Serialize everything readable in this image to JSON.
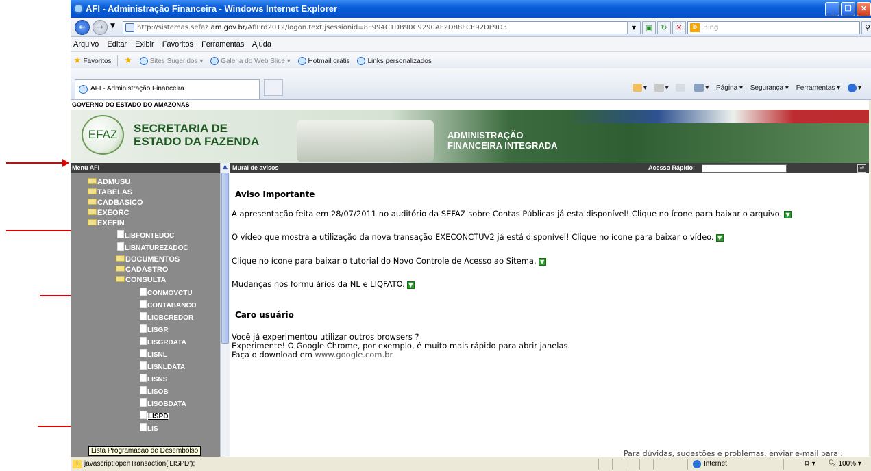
{
  "window": {
    "title": "AFI - Administração Financeira - Windows Internet Explorer",
    "url_prefix": "http://sistemas.sefaz.",
    "url_domain": "am.gov.br",
    "url_suffix": "/AfiPrd2012/logon.text;jsessionid=8F994C1DB90C9290AF2D88FCE92DF9D3",
    "search_placeholder": "Bing",
    "search_logo": "b"
  },
  "menubar": [
    "Arquivo",
    "Editar",
    "Exibir",
    "Favoritos",
    "Ferramentas",
    "Ajuda"
  ],
  "favorites": {
    "label": "Favoritos",
    "items": [
      "Sites Sugeridos ▾",
      "Galeria do Web Slice ▾",
      "Hotmail grátis",
      "Links personalizados"
    ]
  },
  "tab": {
    "title": "AFI - Administração Financeira"
  },
  "commands": {
    "page": "Página ▾",
    "security": "Segurança ▾",
    "tools": "Ferramentas ▾"
  },
  "page": {
    "gov_prefix": "GOVERNO DO ESTADO DO ",
    "gov_state": "AMAZONAS",
    "logo_text": "EFAZ",
    "sec_line1": "SECRETARIA DE",
    "sec_line2": "ESTADO DA FAZENDA",
    "afi_line1": "ADMINISTRAÇÃO",
    "afi_line2": "FINANCEIRA INTEGRADA"
  },
  "menu": {
    "header": "Menu AFI",
    "items": [
      {
        "label": "ADMUSU",
        "type": "folder"
      },
      {
        "label": "TABELAS",
        "type": "folder"
      },
      {
        "label": "CADBASICO",
        "type": "folder"
      },
      {
        "label": "EXEORC",
        "type": "folder"
      },
      {
        "label": "EXEFIN",
        "type": "folder-open"
      },
      {
        "label": "LIBFONTEDOC",
        "type": "doc"
      },
      {
        "label": "LIBNATUREZADOC",
        "type": "doc"
      },
      {
        "label": "DOCUMENTOS",
        "type": "folder"
      },
      {
        "label": "CADASTRO",
        "type": "folder"
      },
      {
        "label": "CONSULTA",
        "type": "folder-open"
      },
      {
        "label": "CONMOVCTU",
        "type": "doc"
      },
      {
        "label": "CONTABANCO",
        "type": "doc"
      },
      {
        "label": "LIOBCREDOR",
        "type": "doc"
      },
      {
        "label": "LISGR",
        "type": "doc"
      },
      {
        "label": "LISGRDATA",
        "type": "doc"
      },
      {
        "label": "LISNL",
        "type": "doc"
      },
      {
        "label": "LISNLDATA",
        "type": "doc"
      },
      {
        "label": "LISNS",
        "type": "doc"
      },
      {
        "label": "LISOB",
        "type": "doc"
      },
      {
        "label": "LISOBDATA",
        "type": "doc"
      },
      {
        "label": "LISPD",
        "type": "doc"
      },
      {
        "label": "LIS",
        "type": "doc"
      }
    ],
    "tooltip": "Lista Programacao de Desembolso"
  },
  "mural": {
    "header": "Mural de avisos",
    "quick_access": "Acesso Rápido:",
    "heading1": "Aviso Importante",
    "p1": "A apresentação feita em 28/07/2011 no auditório da SEFAZ sobre Contas Públicas já esta disponível! Clique no ícone para baixar o arquivo.",
    "p2": "O vídeo que mostra a utilização da nova transação EXECONCTUV2 já está disponível! Clique no ícone para baixar o vídeo.",
    "p3": "Clique no ícone para baixar o tutorial do Novo Controle de Acesso ao Sitema.",
    "p4": "Mudanças nos formulários da NL e LIQFATO.",
    "heading2": "Caro usuário",
    "p5": "Você já experimentou utilizar outros browsers ?",
    "p6": "Experimente! O Google Chrome, por exemplo, é muito mais rápido para abrir janelas.",
    "p7_prefix": "Faça o download em ",
    "p7_link": "www.google.com.br",
    "footer": "Para dúvidas, sugestões e problemas, enviar e-mail para :"
  },
  "status": {
    "text": "javascript:openTransaction('LISPD');",
    "zone": "Internet",
    "zoom": "100%"
  },
  "colors": {
    "menu_bg": "#8a8a8a",
    "header_bg": "#3d3d3d",
    "arrow": "#e00000",
    "title_bar": "#0a5ed7"
  }
}
